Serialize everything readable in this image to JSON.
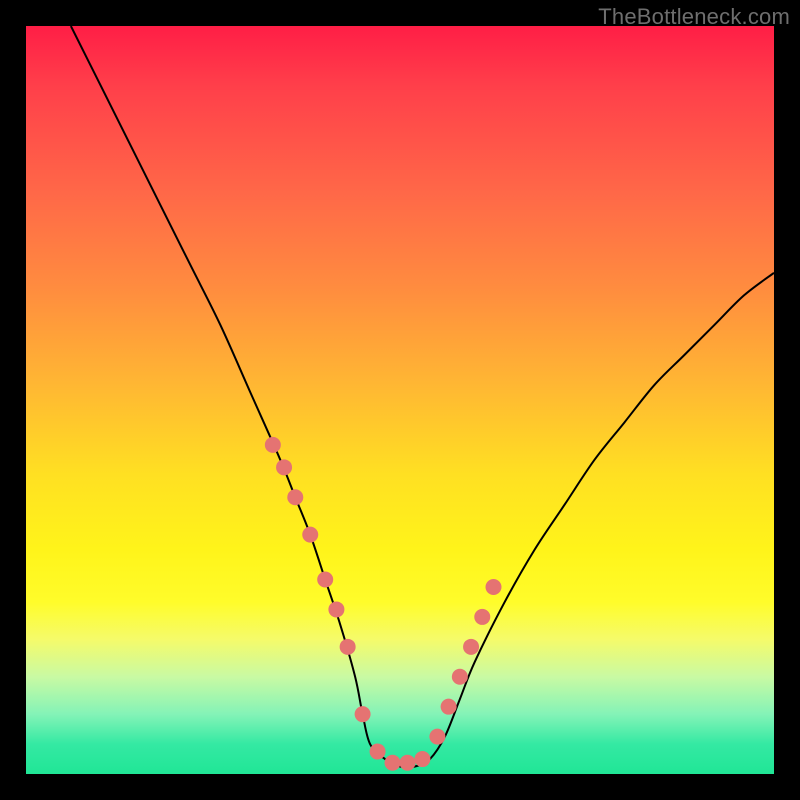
{
  "watermark": "TheBottleneck.com",
  "colors": {
    "page_bg": "#000000",
    "gradient_top": "#ff1e46",
    "gradient_mid": "#ffe022",
    "gradient_bottom": "#20e696",
    "curve": "#000000",
    "marker": "#e57372"
  },
  "chart_data": {
    "type": "line",
    "title": "",
    "xlabel": "",
    "ylabel": "",
    "xlim": [
      0,
      100
    ],
    "ylim": [
      0,
      100
    ],
    "grid": false,
    "series": [
      {
        "name": "bottleneck-curve",
        "x": [
          6,
          10,
          14,
          18,
          22,
          26,
          30,
          34,
          36,
          38,
          40,
          42,
          44,
          45,
          46,
          48,
          50,
          52,
          54,
          56,
          58,
          60,
          64,
          68,
          72,
          76,
          80,
          84,
          88,
          92,
          96,
          100
        ],
        "y": [
          100,
          92,
          84,
          76,
          68,
          60,
          51,
          42,
          37,
          32,
          26,
          20,
          13,
          8,
          4,
          2,
          1,
          1,
          2,
          5,
          10,
          15,
          23,
          30,
          36,
          42,
          47,
          52,
          56,
          60,
          64,
          67
        ]
      }
    ],
    "markers": {
      "name": "highlight-points",
      "x": [
        33,
        34.5,
        36,
        38,
        40,
        41.5,
        43,
        45,
        47,
        49,
        51,
        53,
        55,
        56.5,
        58,
        59.5,
        61,
        62.5
      ],
      "y": [
        44,
        41,
        37,
        32,
        26,
        22,
        17,
        8,
        3,
        1.5,
        1.5,
        2,
        5,
        9,
        13,
        17,
        21,
        25
      ]
    }
  }
}
